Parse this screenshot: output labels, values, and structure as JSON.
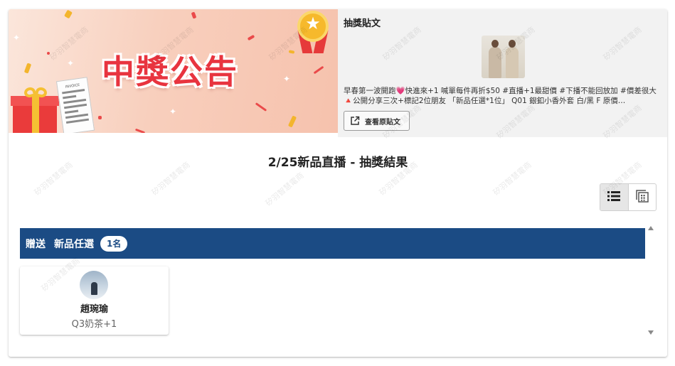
{
  "banner": {
    "title": "中獎公告",
    "receipt_label": "INVOICE"
  },
  "post": {
    "heading": "抽獎貼文",
    "text": "早春第一波開跑💗快進來+1 喊單每件再折$50 #直播+1最甜價 #下播不能回放加 #價差很大 🔺公開分享三次+標記2位朋友 「新品任選*1位」 Q01 銀釦小香外套 白/黑 F 原價…",
    "view_button_label": "查看原貼文"
  },
  "result": {
    "title": "2/25新品直播 - 抽獎結果"
  },
  "view_toggle": {
    "active": "list"
  },
  "prize": {
    "gift_label": "贈送",
    "name": "新品任選",
    "count": "1名"
  },
  "winners": [
    {
      "name": "趙琬瑜",
      "item": "Q3奶茶+1"
    }
  ],
  "watermark": "矽羽智慧電商",
  "colors": {
    "prize_bar": "#1b4b84",
    "banner_title": "#e8343f",
    "post_panel": "#f2f2f2"
  }
}
